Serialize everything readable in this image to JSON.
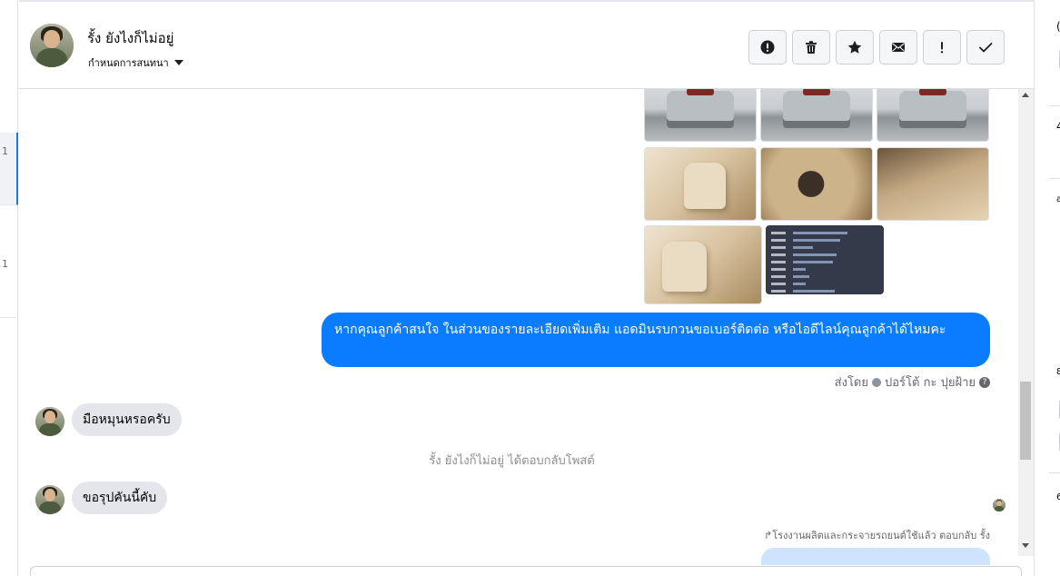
{
  "left_list": {
    "items": [
      {
        "count": "1"
      },
      {
        "count": "1"
      }
    ]
  },
  "right_panel": {
    "fragments": [
      "(",
      "4",
      "a",
      "8",
      "6"
    ]
  },
  "header": {
    "contact_name": "รั้ง ยังไงก็ไม่อยู่",
    "assign_label": "กำหนดการสนทนา",
    "avatar_icon": "user-avatar",
    "actions": [
      {
        "name": "spam-button",
        "icon": "alert-circle-icon"
      },
      {
        "name": "delete-button",
        "icon": "trash-icon"
      },
      {
        "name": "star-button",
        "icon": "star-icon"
      },
      {
        "name": "mark-unread-button",
        "icon": "envelope-icon"
      },
      {
        "name": "follow-up-button",
        "icon": "exclamation-icon"
      },
      {
        "name": "done-button",
        "icon": "check-icon"
      }
    ]
  },
  "thread": {
    "outgoing_message": "หากคุณลูกค้าสนใจ ในส่วนของรายละเอียดเพิ่มเติม แอดมินรบกวนขอเบอร์ติดต่อ หรือไอดีไลน์คุณลูกค้าได้ไหมคะ",
    "sent_by_prefix": "ส่งโดย",
    "sent_by_name": "ปอร์โต้ กะ ปุยฝ้าย",
    "help_icon": "?",
    "incoming_1": "มือหมุนหรอครับ",
    "system_note": "รั้ง ยังไงก็ไม่อยู่ ได้ตอบกลับโพสต์",
    "incoming_2": "ขอรุปคันนี้คับ",
    "reply_note": "โรงงานผลิตและกระจายรถยนต์ใช้แล้ว ตอบกลับ รั้ง"
  },
  "colors": {
    "outgoing_bubble": "#0a7cff",
    "incoming_bubble": "#e4e6eb",
    "accent": "#1877f2"
  }
}
